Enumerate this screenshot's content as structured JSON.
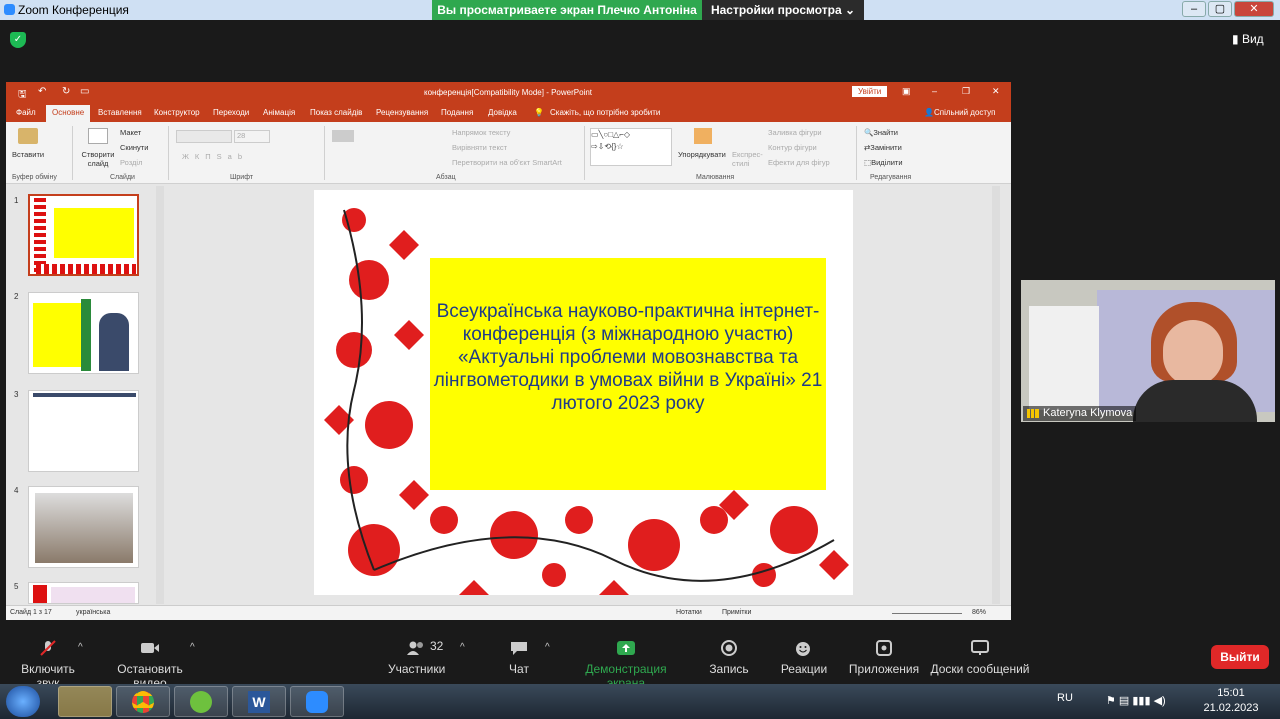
{
  "zoom": {
    "window_title": "Zoom Конференция",
    "share_banner": "Вы просматриваете экран Плечко Антоніна",
    "view_settings": "Настройки просмотра",
    "view_button": "Вид",
    "participant_name": "Kateryna Klymova",
    "participants_count": "32",
    "toolbar": {
      "mute": "Включить звук",
      "video": "Остановить видео",
      "participants": "Участники",
      "chat": "Чат",
      "share": "Демонстрация экрана",
      "record": "Запись",
      "reactions": "Реакции",
      "apps": "Приложения",
      "whiteboards": "Доски сообщений",
      "leave": "Выйти"
    }
  },
  "ppt": {
    "title": "конференція[Compatibility Mode] - PowerPoint",
    "signin": "Увійти",
    "tabs": [
      "Файл",
      "Основне",
      "Вставлення",
      "Конструктор",
      "Переходи",
      "Анімація",
      "Показ слайдів",
      "Рецензування",
      "Подання",
      "Довідка"
    ],
    "tell_me": "Скажіть, що потрібно зробити",
    "share": "Спільний доступ",
    "ribbon": {
      "paste": "Вставити",
      "clipboard": "Буфер обміну",
      "new_slide": "Створити слайд",
      "layout": "Макет",
      "reset": "Скинути",
      "section": "Розділ",
      "slides": "Слайди",
      "font": "Шрифт",
      "font_size": "28",
      "text_direction": "Напрямок тексту",
      "align_text": "Вирівняти текст",
      "smartart": "Перетворити на об'єкт SmartArt",
      "paragraph": "Абзац",
      "arrange": "Упорядкувати",
      "quick_styles": "Експрес-стилі",
      "shape_fill": "Заливка фігури",
      "shape_outline": "Контур фігури",
      "shape_effects": "Ефекти для фігур",
      "drawing": "Малювання",
      "find": "Знайти",
      "replace": "Замінити",
      "select": "Виділити",
      "editing": "Редагування"
    },
    "thumb_numbers": [
      "1",
      "2",
      "3",
      "4",
      "5"
    ],
    "slide_text": "Всеукраїнська науково-практична інтернет-конференція (з міжнародною участю) «Актуальні проблеми мовознавства та лінгвометодики в умовах війни в Україні» 21 лютого 2023 року",
    "status": {
      "slide": "Слайд 1 з 17",
      "lang": "українська",
      "notes": "Нотатки",
      "comments": "Примітки",
      "zoom": "86%"
    }
  },
  "taskbar": {
    "lang": "RU",
    "time": "15:01",
    "date": "21.02.2023"
  },
  "colors": {
    "ppt_accent": "#c43e1c",
    "share_green": "#2fa84f",
    "leave_red": "#e02828",
    "slide_yellow": "#ffff00"
  }
}
